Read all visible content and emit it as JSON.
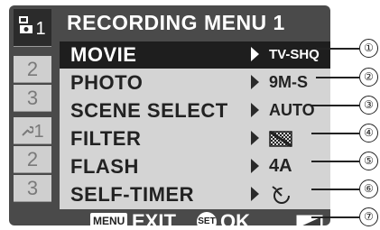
{
  "title": "RECORDING MENU 1",
  "tabs": [
    {
      "label": "1",
      "icon": "camera-icon",
      "active": true
    },
    {
      "label": "2"
    },
    {
      "label": "3"
    },
    {
      "label": "1",
      "icon": "wrench-icon"
    },
    {
      "label": "2"
    },
    {
      "label": "3"
    }
  ],
  "menu_items": [
    {
      "label": "MOVIE",
      "value": "TV-SHQ",
      "selected": true
    },
    {
      "label": "PHOTO",
      "value": "9M-S"
    },
    {
      "label": "SCENE SELECT",
      "value": "AUTO"
    },
    {
      "label": "FILTER",
      "value_icon": "filter-icon"
    },
    {
      "label": "FLASH",
      "value": "4A",
      "value_icon": "flash-icon"
    },
    {
      "label": "SELF-TIMER",
      "value_icon": "self-timer-icon"
    }
  ],
  "footer": {
    "menu_key": "MENU",
    "exit_label": "EXIT",
    "set_key": "SET",
    "ok_label": "OK",
    "battery_icon": "battery-icon"
  },
  "callouts": [
    "①",
    "②",
    "③",
    "④",
    "⑤",
    "⑥",
    "⑦"
  ],
  "colors": {
    "screen_bg": "#4a4a4a",
    "list_bg": "#d4d4d4",
    "selected_bg": "#1e1e1e"
  }
}
